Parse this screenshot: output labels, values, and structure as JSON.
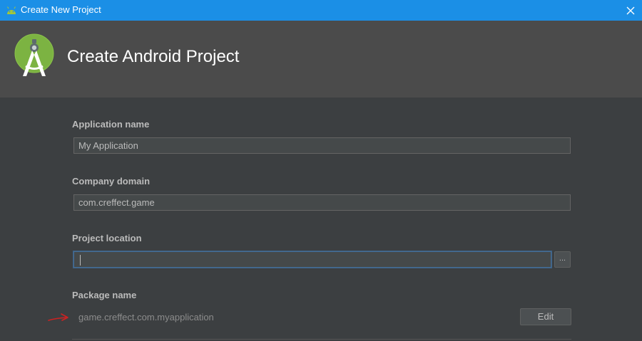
{
  "titlebar": {
    "title": "Create New Project",
    "close_glyph": "✕",
    "app_icon": "android-icon",
    "color": "#1b8fe6"
  },
  "header": {
    "title": "Create Android Project",
    "logo": "android-studio-logo",
    "background": "#4b4b4b"
  },
  "form": {
    "application_name": {
      "label": "Application name",
      "value": "My Application"
    },
    "company_domain": {
      "label": "Company domain",
      "value": "com.creffect.game"
    },
    "project_location": {
      "label": "Project location",
      "value": "",
      "browse_label": "..."
    },
    "package_name": {
      "label": "Package name",
      "value": "game.creffect.com.myapplication",
      "edit_label": "Edit"
    }
  },
  "annotation": {
    "icon": "red-arrow-icon",
    "color": "#cc2222"
  }
}
